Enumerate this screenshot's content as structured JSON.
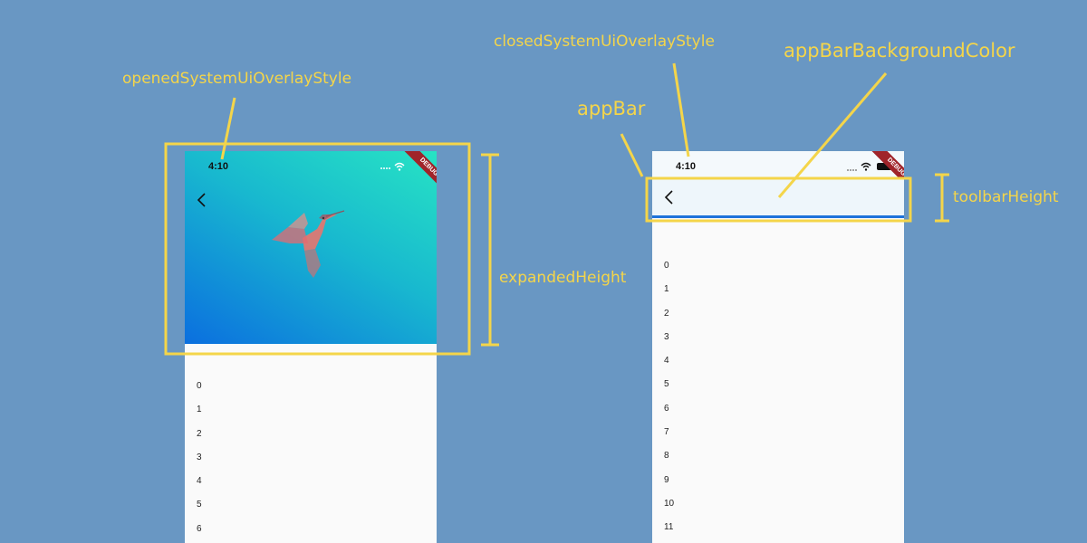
{
  "colors": {
    "background": "#6997c3",
    "annotation": "#f4d54a",
    "gradient_start": "#27e3c4",
    "gradient_end": "#0b6fdf",
    "collapsed_appbar": "#eef6fb",
    "collapsed_appbar_border": "#1e73db"
  },
  "labels": {
    "opened_style": "openedSystemUiOverlayStyle",
    "closed_style": "closedSystemUiOverlayStyle",
    "app_bar_bg": "appBarBackgroundColor",
    "app_bar": "appBar",
    "toolbar_height": "toolbarHeight",
    "expanded_height": "expandedHeight"
  },
  "left_phone": {
    "time": "4:10",
    "ribbon": "DEBUG",
    "list": [
      "0",
      "1",
      "2",
      "3",
      "4",
      "5",
      "6"
    ]
  },
  "right_phone": {
    "time": "4:10",
    "ribbon": "DEBUG",
    "list": [
      "0",
      "1",
      "2",
      "3",
      "4",
      "5",
      "6",
      "7",
      "8",
      "9",
      "10",
      "11"
    ]
  },
  "icons": {
    "back": "chevron-left-icon",
    "wifi": "wifi-icon",
    "battery": "battery-icon",
    "signal": "signal-dots-icon",
    "bird": "hummingbird-icon"
  }
}
